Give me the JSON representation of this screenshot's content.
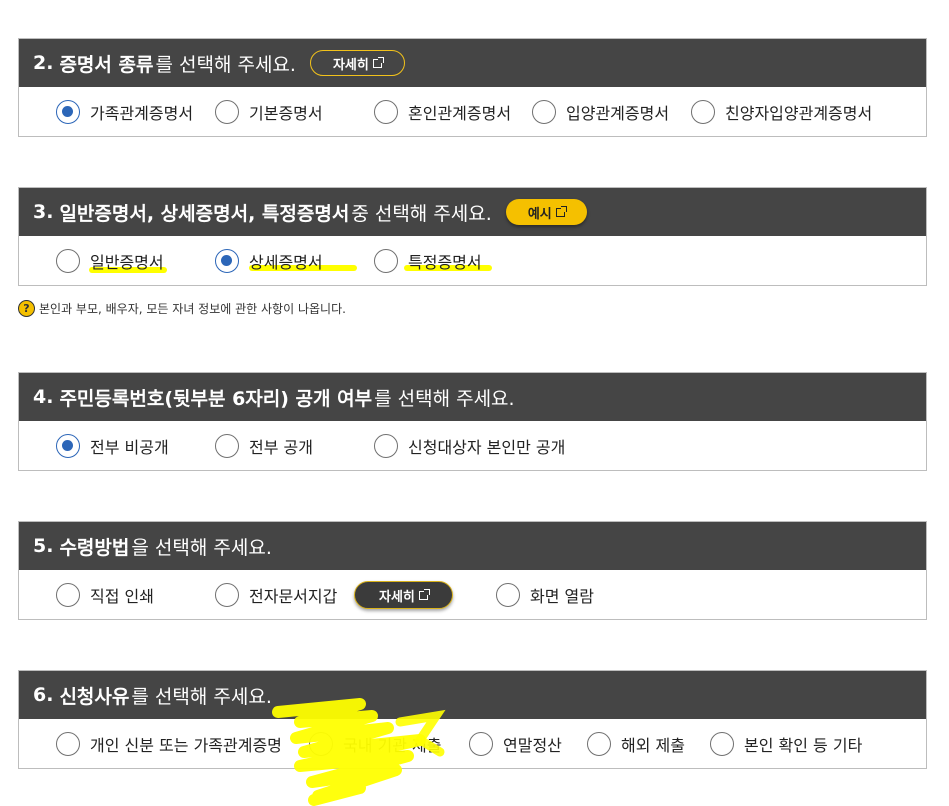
{
  "sections": [
    {
      "num": "2.",
      "title_bold": "증명서 종류",
      "title_rest": "를 선택해 주세요.",
      "head_button": "자세히",
      "options": [
        "가족관계증명서",
        "기본증명서",
        "혼인관계증명서",
        "입양관계증명서",
        "친양자입양관계증명서"
      ],
      "selected": "가족관계증명서"
    },
    {
      "num": "3.",
      "title_bold": "일반증명서, 상세증명서, 특정증명서",
      "title_rest": " 중 선택해 주세요.",
      "head_button": "예시",
      "options": [
        "일반증명서",
        "상세증명서",
        "특정증명서"
      ],
      "selected": "상세증명서",
      "note": "본인과 부모, 배우자, 모든 자녀 정보에 관한 사항이 나옵니다."
    },
    {
      "num": "4.",
      "title_bold": "주민등록번호(뒷부분 6자리) 공개 여부",
      "title_rest": "를 선택해 주세요.",
      "options": [
        "전부 비공개",
        "전부 공개",
        "신청대상자 본인만 공개"
      ],
      "selected": "전부 비공개"
    },
    {
      "num": "5.",
      "title_bold": "수령방법",
      "title_rest": "을 선택해 주세요.",
      "options": [
        "직접 인쇄",
        "전자문서지갑",
        "화면 열람"
      ],
      "inline_button": "자세히",
      "selected": ""
    },
    {
      "num": "6.",
      "title_bold": "신청사유",
      "title_rest": "를 선택해 주세요.",
      "options": [
        "개인 신분 또는 가족관계증명",
        "국내 기관 제출",
        "연말정산",
        "해외 제출",
        "본인 확인 등 기타"
      ],
      "selected": ""
    }
  ],
  "colors": {
    "header_bg": "#454545",
    "accent_yellow": "#f5c000",
    "radio_checked": "#2c66b8",
    "highlight": "#ffff00"
  },
  "icons": [
    "external-link-icon",
    "question-icon",
    "radio-icon"
  ]
}
